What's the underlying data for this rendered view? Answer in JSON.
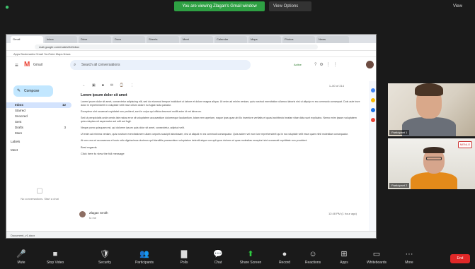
{
  "zoom": {
    "share_banner": "You are viewing Zlagan's Gmail window",
    "view_options": "View Options",
    "view_label": "View",
    "end_label": "End",
    "controls": [
      {
        "name": "mute",
        "icon": "microphone-icon",
        "glyph": "🎤",
        "label": "Mute"
      },
      {
        "name": "stop-video",
        "icon": "camera-icon",
        "glyph": "■",
        "label": "Stop Video"
      },
      {
        "name": "security",
        "icon": "shield-icon",
        "glyph": "🛡",
        "label": "Security"
      },
      {
        "name": "participants",
        "icon": "participants-icon",
        "glyph": "👥",
        "label": "Participants"
      },
      {
        "name": "polls",
        "icon": "polls-icon",
        "glyph": "▇",
        "label": "Polls"
      },
      {
        "name": "chat",
        "icon": "chat-icon",
        "glyph": "💬",
        "label": "Chat"
      },
      {
        "name": "share-screen",
        "icon": "share-screen-icon",
        "glyph": "⬆",
        "label": "Share Screen"
      },
      {
        "name": "record",
        "icon": "record-icon",
        "glyph": "●",
        "label": "Record"
      },
      {
        "name": "reactions",
        "icon": "reactions-icon",
        "glyph": "☺",
        "label": "Reactions"
      },
      {
        "name": "apps",
        "icon": "apps-icon",
        "glyph": "⊞",
        "label": "Apps"
      },
      {
        "name": "whiteboards",
        "icon": "whiteboard-icon",
        "glyph": "▭",
        "label": "Whiteboards"
      },
      {
        "name": "more",
        "icon": "more-icon",
        "glyph": "···",
        "label": "More"
      }
    ]
  },
  "browser": {
    "tabs": [
      "Gmail",
      "Inbox",
      "Drive",
      "Docs",
      "Sheets",
      "Meet",
      "Calendar",
      "Maps",
      "Photos",
      "News"
    ],
    "address": "mail.google.com/mail/u/0/#inbox",
    "bookmarks": "Apps   Bookmarks   Gmail   YouTube   Maps   News",
    "taskbar_file": "Document_v1.docx"
  },
  "gmail": {
    "app_name": "Gmail",
    "search_placeholder": "Search all conversations",
    "status": "Active",
    "compose_label": "Compose",
    "sidebar": [
      {
        "label": "Inbox",
        "count": "12",
        "active": true
      },
      {
        "label": "Starred",
        "count": ""
      },
      {
        "label": "Snoozed",
        "count": ""
      },
      {
        "label": "Sent",
        "count": ""
      },
      {
        "label": "Drafts",
        "count": "3"
      },
      {
        "label": "More",
        "count": ""
      }
    ],
    "section_labels": "Labels",
    "section_meet": "Meet",
    "chat_placeholder": "No conversations. Start a chat",
    "pager": "1–50 of 214",
    "email": {
      "subject": "Lorem ipsum dolor sit amet",
      "paragraphs": [
        "Lorem ipsum dolor sit amet, consectetur adipiscing elit, sed do eiusmod tempor incididunt ut labore et dolore magna aliqua. Ut enim ad minim veniam, quis nostrud exercitation ullamco laboris nisi ut aliquip ex ea commodo consequat. Duis aute irure dolor in reprehenderit in voluptate velit esse cillum dolore eu fugiat nulla pariatur.",
        "Excepteur sint occaecat cupidatat non proident, sunt in culpa qui officia deserunt mollit anim id est laborum.",
        "Sed ut perspiciatis unde omnis iste natus error sit voluptatem accusantium doloremque laudantium, totam rem aperiam, eaque ipsa quae ab illo inventore veritatis et quasi architecto beatae vitae dicta sunt explicabo. Nemo enim ipsam voluptatem quia voluptas sit aspernatur aut odit aut fugit.",
        "Neque porro quisquam est, qui dolorem ipsum quia dolor sit amet, consectetur, adipisci velit.",
        "Ut enim ad minima veniam, quis nostrum exercitationem ullam corporis suscipit laboriosam, nisi ut aliquid ex ea commodi consequatur. Quis autem vel eum iure reprehenderit qui in ea voluptate velit esse quam nihil molestiae consequatur.",
        "At vero eos et accusamus et iusto odio dignissimos ducimus qui blanditiis praesentium voluptatum deleniti atque corrupti quos dolores et quas molestias excepturi sint occaecati cupiditate non provident."
      ],
      "link_text": "Click here to view the full message",
      "sign_off": "Best regards"
    },
    "reply": {
      "from": "Zlagan Smith",
      "to": "to me",
      "meta": "12:48 PM (1 hour ago)"
    }
  },
  "participants": [
    {
      "name": "Participant 1"
    },
    {
      "name": "Participant 2",
      "badge": "MENLO"
    }
  ]
}
